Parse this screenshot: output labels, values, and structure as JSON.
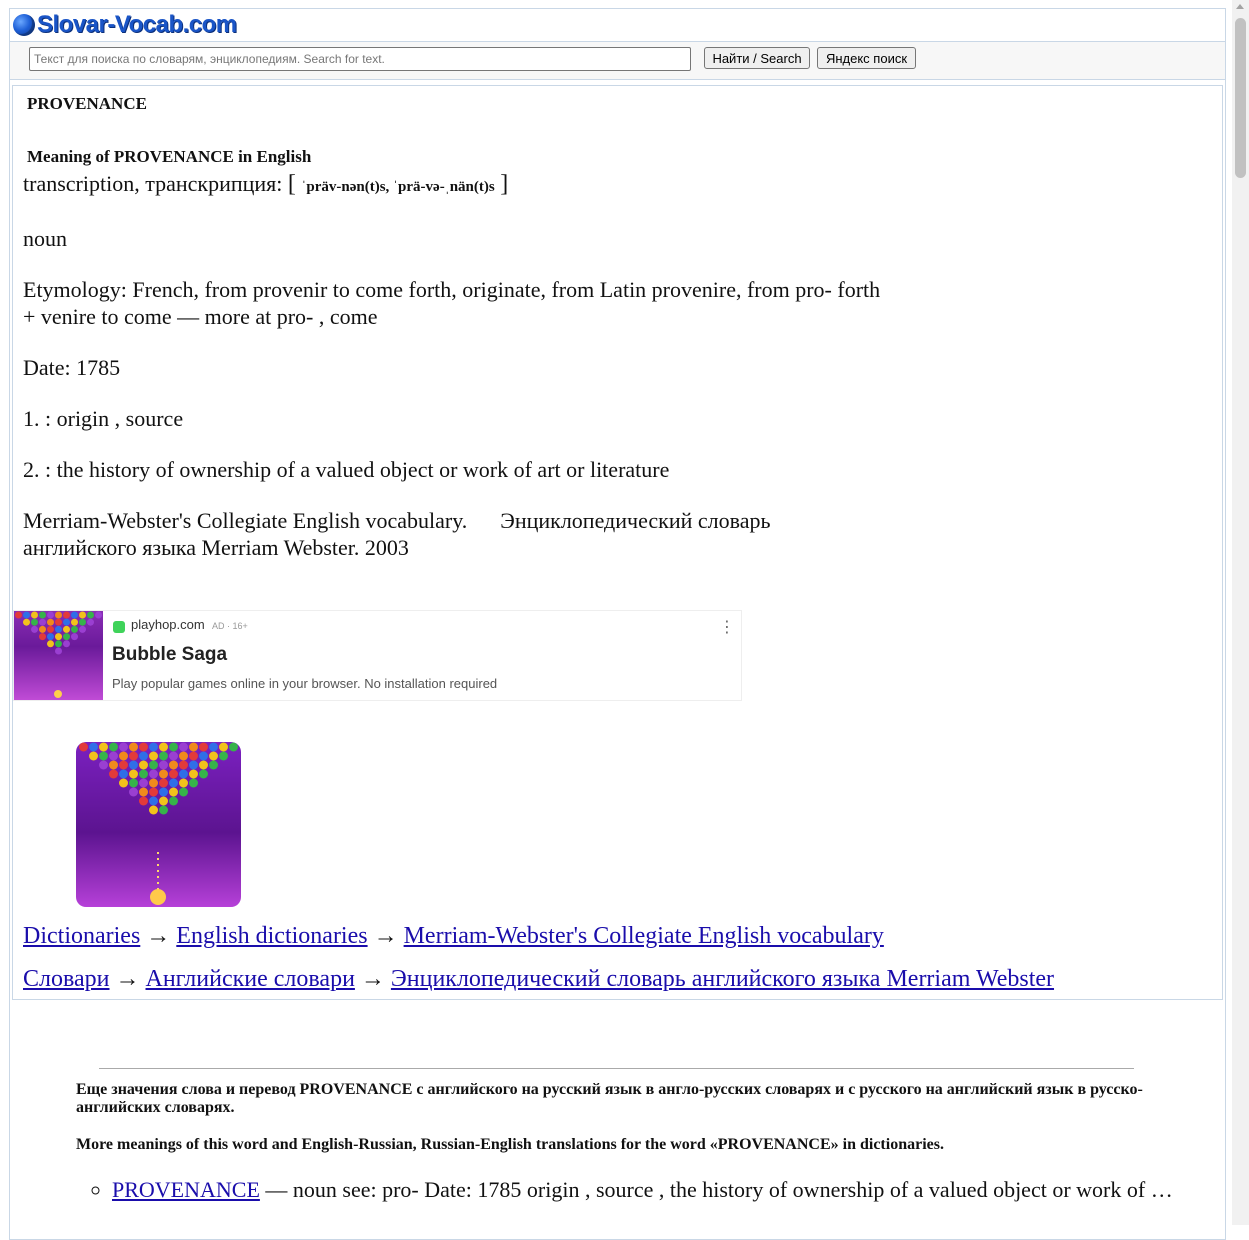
{
  "site": {
    "logo_text": "Slovar-Vocab.com"
  },
  "search": {
    "placeholder": "Текст для поиска по словарям, энциклопедиям. Search for text.",
    "value": "",
    "search_button": "Найти / Search",
    "yandex_button": "Яндекс поиск"
  },
  "entry": {
    "word": "PROVENANCE",
    "meaning_heading": "Meaning of PROVENANCE in English",
    "transcription_label": "transcription, транскрипция:",
    "bracket_open": "[",
    "transcription": "ˈpräv-nən(t)s, ˈprä-və-ˌnän(t)s",
    "bracket_close": "]",
    "part_of_speech": "noun",
    "etymology": "Etymology: French, from provenir to come forth, originate, from Latin provenire, from pro- forth + venire to come — more at pro- , come",
    "date": "Date: 1785",
    "def1": "1. : origin , source",
    "def2": "2. : the history of ownership of a valued object or work of art or literature",
    "source": "Merriam-Webster's Collegiate English vocabulary.      Энциклопедический словарь английского языка Merriam Webster. 2003"
  },
  "ad": {
    "domain": "playhop.com",
    "tag": "AD · 16+",
    "menu": "⋮",
    "title": "Bubble Saga",
    "description": "Play popular games online in your browser. No installation required"
  },
  "breadcrumbs_en": {
    "item1": "Dictionaries",
    "item2": "English dictionaries",
    "item3": "Merriam-Webster's Collegiate English vocabulary",
    "arrow": "→"
  },
  "breadcrumbs_ru": {
    "item1": "Словари",
    "item2": "Английские словари",
    "item3": "Энциклопедический словарь английского языка Merriam Webster",
    "arrow": "→"
  },
  "more": {
    "heading_ru": "Еще значения слова и перевод PROVENANCE с английского на русский язык в англо-русских словарях и с русского на английский язык в русско-английских словарях.",
    "heading_en": "More meanings of this word and English-Russian, Russian-English translations for the word «PROVENANCE» in dictionaries.",
    "items": [
      {
        "link": "PROVENANCE",
        "text": " — noun see: pro- Date: 1785 origin , source , the history of ownership of a valued object or work of …"
      }
    ]
  }
}
